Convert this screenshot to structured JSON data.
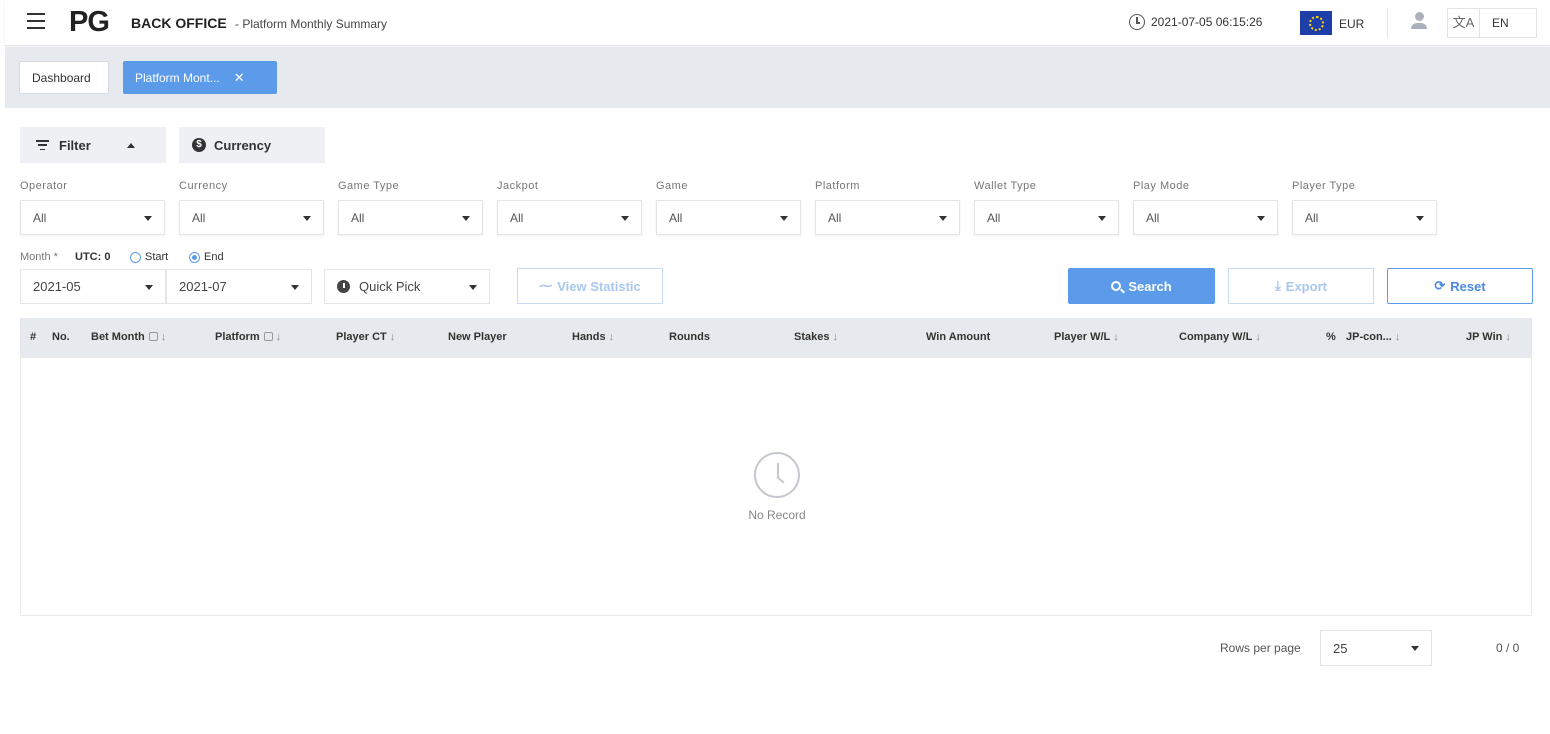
{
  "header": {
    "logo": "PG",
    "app_title": "BACK OFFICE",
    "page_subtitle": "- Platform Monthly Summary",
    "datetime": "2021-07-05 06:15:26",
    "currency": "EUR",
    "language": "EN",
    "translate_glyph": "文A"
  },
  "tabs": [
    {
      "label": "Dashboard"
    },
    {
      "label": "Platform Mont...",
      "close": "✕"
    }
  ],
  "filter": {
    "filter_label": "Filter",
    "currency_label": "Currency",
    "fields": [
      {
        "label": "Operator",
        "value": "All"
      },
      {
        "label": "Currency",
        "value": "All"
      },
      {
        "label": "Game Type",
        "value": "All"
      },
      {
        "label": "Jackpot",
        "value": "All"
      },
      {
        "label": "Game",
        "value": "All"
      },
      {
        "label": "Platform",
        "value": "All"
      },
      {
        "label": "Wallet Type",
        "value": "All"
      },
      {
        "label": "Play Mode",
        "value": "All"
      },
      {
        "label": "Player Type",
        "value": "All"
      }
    ]
  },
  "month": {
    "label": "Month *",
    "utc": "UTC: 0",
    "radio_start": "Start",
    "radio_end": "End",
    "selected_radio": "End",
    "from": "2021-05",
    "to": "2021-07",
    "quick_pick": "Quick Pick"
  },
  "actions": {
    "view_statistic": "View Statistic",
    "search": "Search",
    "export": "Export",
    "reset": "Reset"
  },
  "table": {
    "columns": [
      {
        "label": "#",
        "sortable": false,
        "locked": false
      },
      {
        "label": "No.",
        "sortable": false,
        "locked": false
      },
      {
        "label": "Bet Month",
        "sortable": true,
        "locked": true
      },
      {
        "label": "Platform",
        "sortable": true,
        "locked": true
      },
      {
        "label": "Player CT",
        "sortable": true,
        "locked": false
      },
      {
        "label": "New Player",
        "sortable": false,
        "locked": false
      },
      {
        "label": "Hands",
        "sortable": true,
        "locked": false
      },
      {
        "label": "Rounds",
        "sortable": false,
        "locked": false
      },
      {
        "label": "Stakes",
        "sortable": true,
        "locked": false
      },
      {
        "label": "Win Amount",
        "sortable": false,
        "locked": false
      },
      {
        "label": "Player W/L",
        "sortable": true,
        "locked": false
      },
      {
        "label": "Company W/L",
        "sortable": true,
        "locked": false
      },
      {
        "label": "%",
        "sortable": false,
        "locked": false
      },
      {
        "label": "JP-con...",
        "sortable": true,
        "locked": false
      },
      {
        "label": "JP Win",
        "sortable": true,
        "locked": false
      }
    ],
    "sort_glyph": "↓",
    "empty_text": "No Record"
  },
  "pagination": {
    "rows_label": "Rows per page",
    "rows_value": "25",
    "count": "0 / 0"
  },
  "colors": {
    "accent": "#5b9bea",
    "header_bg": "#ffffff",
    "tabbar_bg": "#e6e9ee",
    "table_head_bg": "#e6e9ee"
  }
}
